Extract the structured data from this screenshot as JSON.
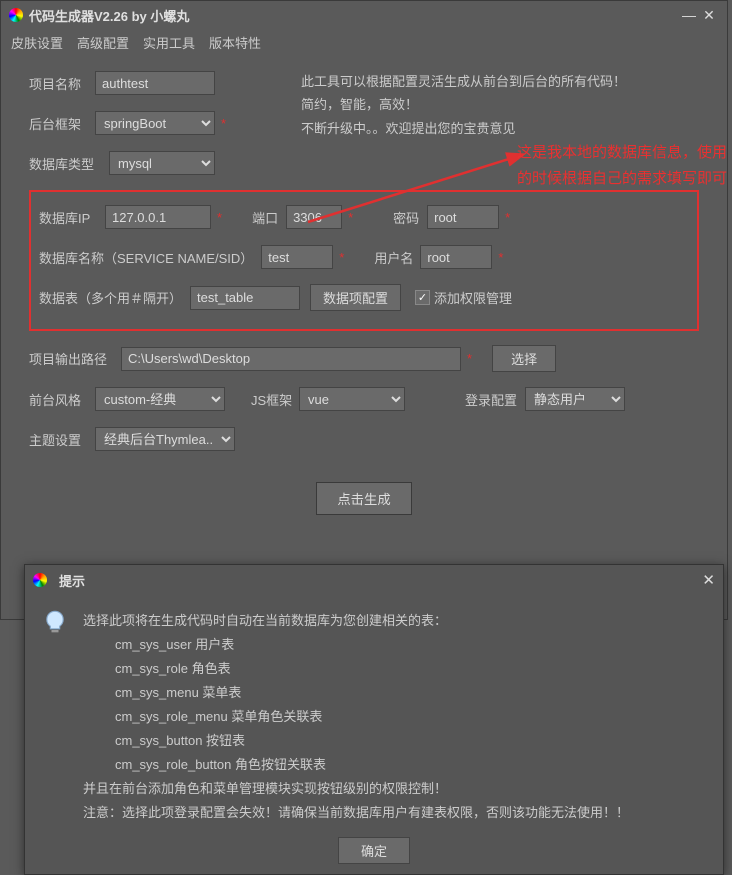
{
  "window": {
    "title": "代码生成器V2.26 by 小螺丸"
  },
  "menu": {
    "skin": "皮肤设置",
    "advanced": "高级配置",
    "tools": "实用工具",
    "version": "版本特性"
  },
  "intro": {
    "l1": "此工具可以根据配置灵活生成从前台到后台的所有代码！",
    "l2": "简约，智能，高效！",
    "l3": "不断升级中。。欢迎提出您的宝贵意见"
  },
  "annotation": "这是我本地的数据库信息，使用的时候根据自己的需求填写即可",
  "form": {
    "projectName": {
      "label": "项目名称",
      "value": "authtest"
    },
    "backend": {
      "label": "后台框架",
      "value": "springBoot"
    },
    "dbType": {
      "label": "数据库类型",
      "value": "mysql"
    },
    "dbIp": {
      "label": "数据库IP",
      "value": "127.0.0.1"
    },
    "port": {
      "label": "端口",
      "value": "3306"
    },
    "password": {
      "label": "密码",
      "value": "root"
    },
    "dbName": {
      "label": "数据库名称（SERVICE NAME/SID）",
      "value": "test"
    },
    "username": {
      "label": "用户名",
      "value": "root"
    },
    "tables": {
      "label": "数据表（多个用＃隔开）",
      "value": "test_table"
    },
    "dataConfig": "数据项配置",
    "addAuth": "添加权限管理",
    "outputPath": {
      "label": "项目输出路径",
      "value": "C:\\Users\\wd\\Desktop"
    },
    "choose": "选择",
    "frontStyle": {
      "label": "前台风格",
      "value": "custom-经典"
    },
    "jsFramework": {
      "label": "JS框架",
      "value": "vue"
    },
    "loginConfig": {
      "label": "登录配置",
      "value": "静态用户"
    },
    "theme": {
      "label": "主题设置",
      "value": "经典后台Thymlea..."
    },
    "generate": "点击生成"
  },
  "dialog": {
    "title": "提示",
    "l0": "选择此项将在生成代码时自动在当前数据库为您创建相关的表：",
    "t1": "cm_sys_user 用户表",
    "t2": "cm_sys_role 角色表",
    "t3": "cm_sys_menu 菜单表",
    "t4": "cm_sys_role_menu 菜单角色关联表",
    "t5": "cm_sys_button 按钮表",
    "t6": "cm_sys_role_button 角色按钮关联表",
    "l7": "并且在前台添加角色和菜单管理模块实现按钮级别的权限控制！",
    "l8": "注意：选择此项登录配置会失效！请确保当前数据库用户有建表权限，否则该功能无法使用！！",
    "ok": "确定"
  }
}
